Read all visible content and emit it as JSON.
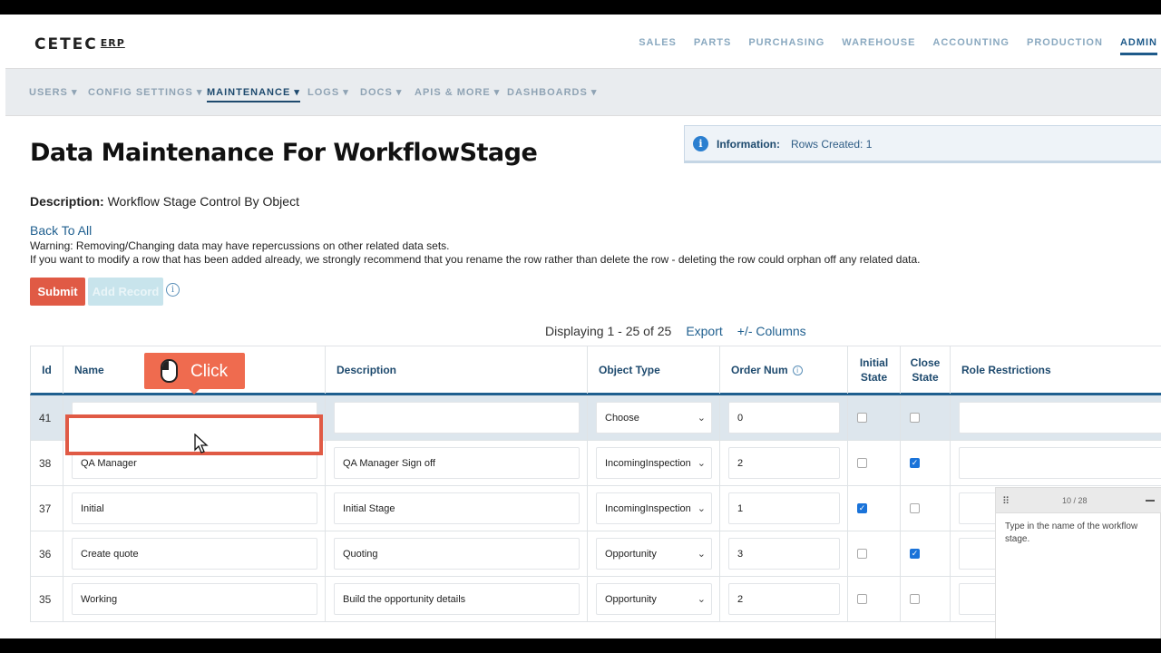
{
  "app": {
    "logo": "CETEC",
    "logo_suffix": "ERP"
  },
  "main_nav": [
    "SALES",
    "PARTS",
    "PURCHASING",
    "WAREHOUSE",
    "ACCOUNTING",
    "PRODUCTION",
    "ADMIN"
  ],
  "main_nav_active": "ADMIN",
  "sub_nav": [
    "USERS ▾",
    "CONFIG SETTINGS ▾",
    "MAINTENANCE ▾",
    "LOGS ▾",
    "DOCS ▾",
    "APIS & MORE ▾",
    "DASHBOARDS ▾"
  ],
  "sub_nav_active": "MAINTENANCE ▾",
  "page": {
    "title": "Data Maintenance For WorkflowStage",
    "description_label": "Description:",
    "description_value": "Workflow Stage Control By Object",
    "back_link": "Back To All",
    "warning_line1": "Warning: Removing/Changing data may have repercussions on other related data sets.",
    "warning_line2": "If you want to modify a row that has been added already, we strongly recommend that you rename the row rather than delete the row - deleting the row could orphan off any related data."
  },
  "info_banner": {
    "label": "Information:",
    "message": "Rows Created: 1",
    "icon": "info-icon"
  },
  "buttons": {
    "submit": "Submit",
    "add_record": "Add Record"
  },
  "pager": {
    "display": "Displaying 1 - 25 of 25",
    "export": "Export",
    "columns": "+/- Columns"
  },
  "table": {
    "headers": {
      "id": "Id",
      "name": "Name",
      "description": "Description",
      "object_type": "Object Type",
      "order_num": "Order Num",
      "initial_state_1": "Initial",
      "initial_state_2": "State",
      "close_state_1": "Close",
      "close_state_2": "State",
      "role_restrictions": "Role Restrictions"
    },
    "rows": [
      {
        "id": "41",
        "name": "",
        "description": "",
        "object_type": "Choose",
        "order_num": "0",
        "initial": false,
        "close": false
      },
      {
        "id": "38",
        "name": "QA Manager",
        "description": "QA Manager Sign off",
        "object_type": "IncomingInspection",
        "order_num": "2",
        "initial": false,
        "close": true
      },
      {
        "id": "37",
        "name": "Initial",
        "description": "Initial Stage",
        "object_type": "IncomingInspection",
        "order_num": "1",
        "initial": true,
        "close": false
      },
      {
        "id": "36",
        "name": "Create quote",
        "description": "Quoting",
        "object_type": "Opportunity",
        "order_num": "3",
        "initial": false,
        "close": true
      },
      {
        "id": "35",
        "name": "Working",
        "description": "Build the opportunity details",
        "object_type": "Opportunity",
        "order_num": "2",
        "initial": false,
        "close": false
      }
    ]
  },
  "click_tip": {
    "label": "Click",
    "icon": "mouse-icon"
  },
  "guide_panel": {
    "count": "10 / 28",
    "text": "Type in the name of the workflow stage."
  },
  "colors": {
    "accent": "#1f5f8f",
    "submit": "#e05a45",
    "highlight": "#e05a45",
    "tip": "#ef6b4f"
  }
}
